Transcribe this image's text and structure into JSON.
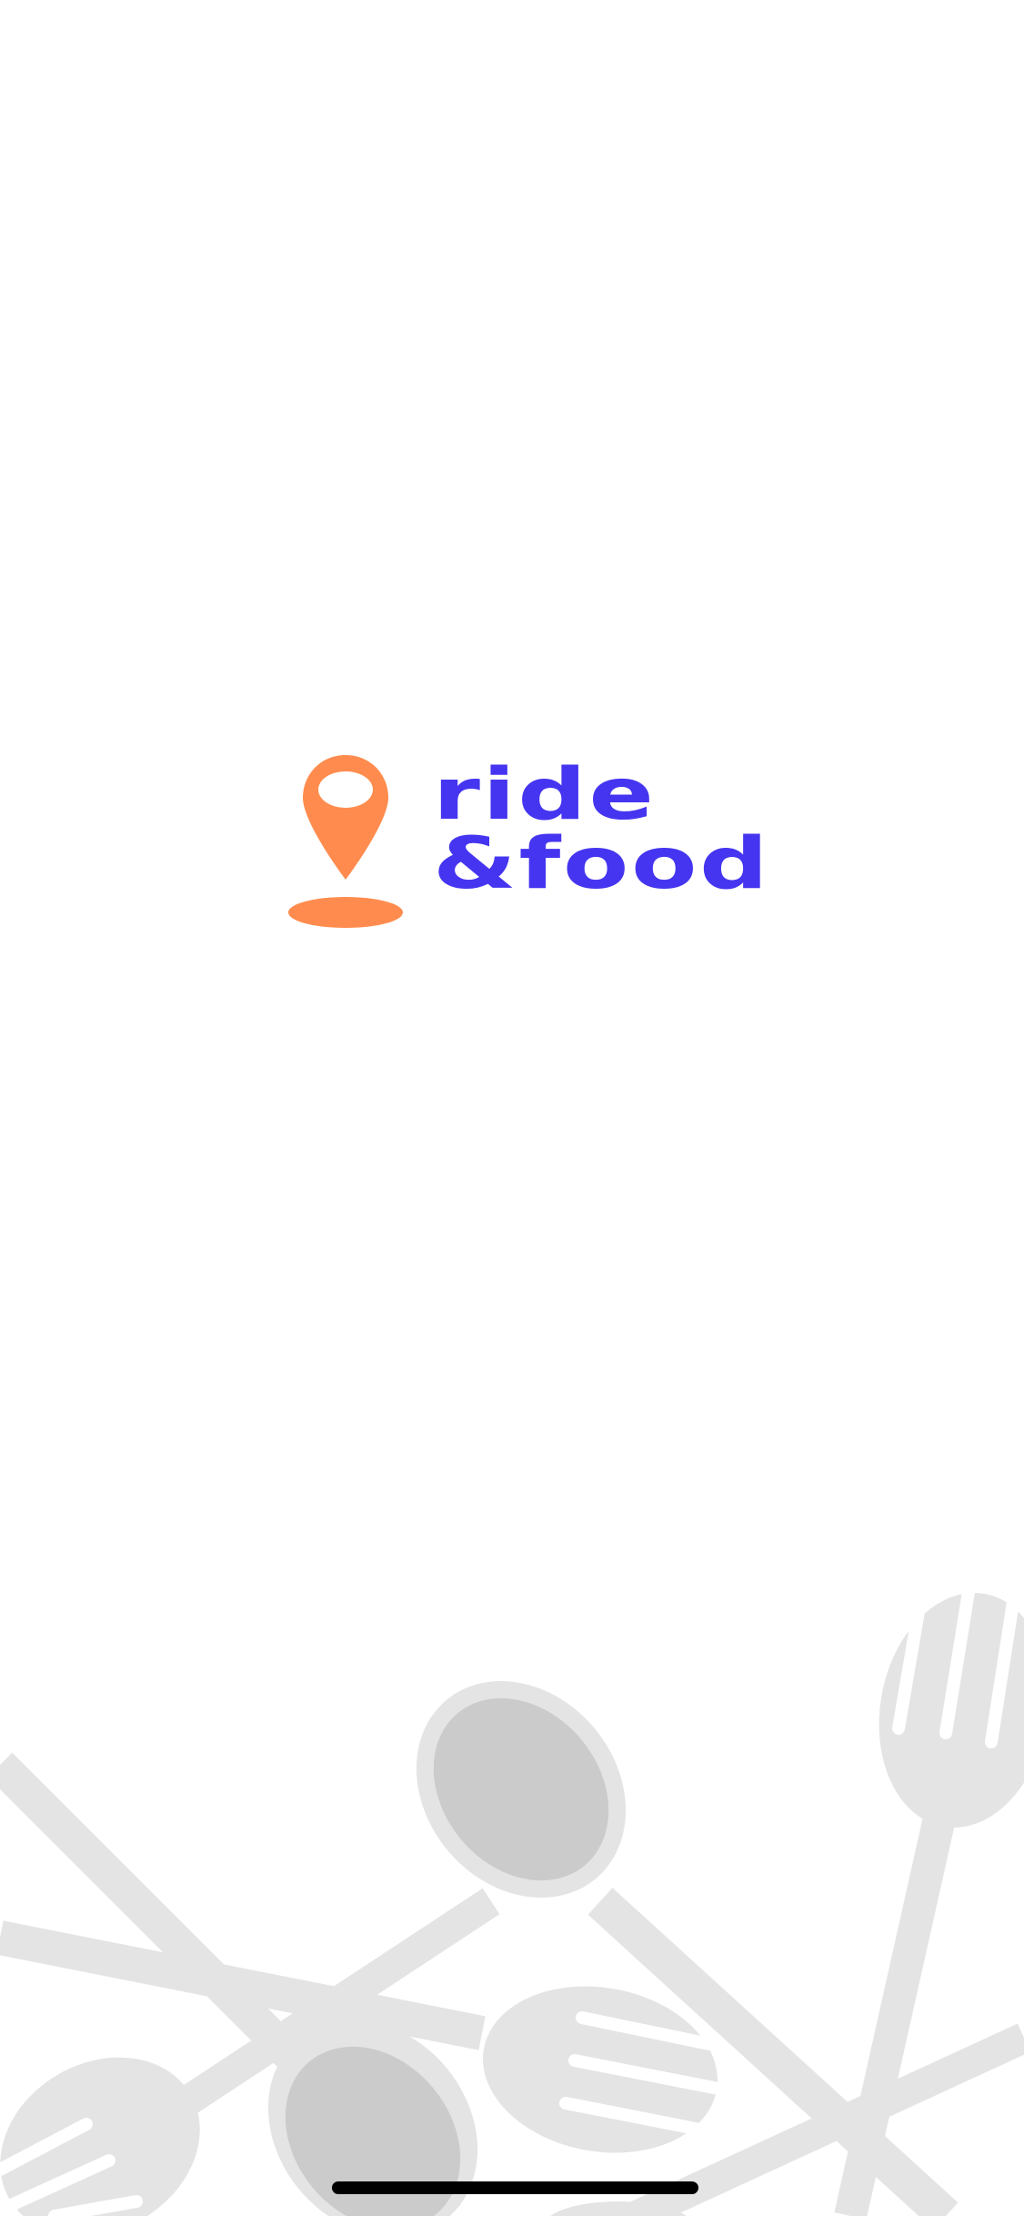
{
  "app": {
    "brand_line_1": "ride",
    "brand_line_2": "&food"
  },
  "icons": {
    "logo_pin": "location-pin-icon",
    "background": "cutlery-illustration"
  },
  "colors": {
    "brand_orange": "#ff8c4e",
    "brand_blue": "#4535f0",
    "illustration_light": "#e4e4e4",
    "illustration_dark": "#cbcbcb",
    "background": "#ffffff",
    "home_indicator": "#000000"
  }
}
